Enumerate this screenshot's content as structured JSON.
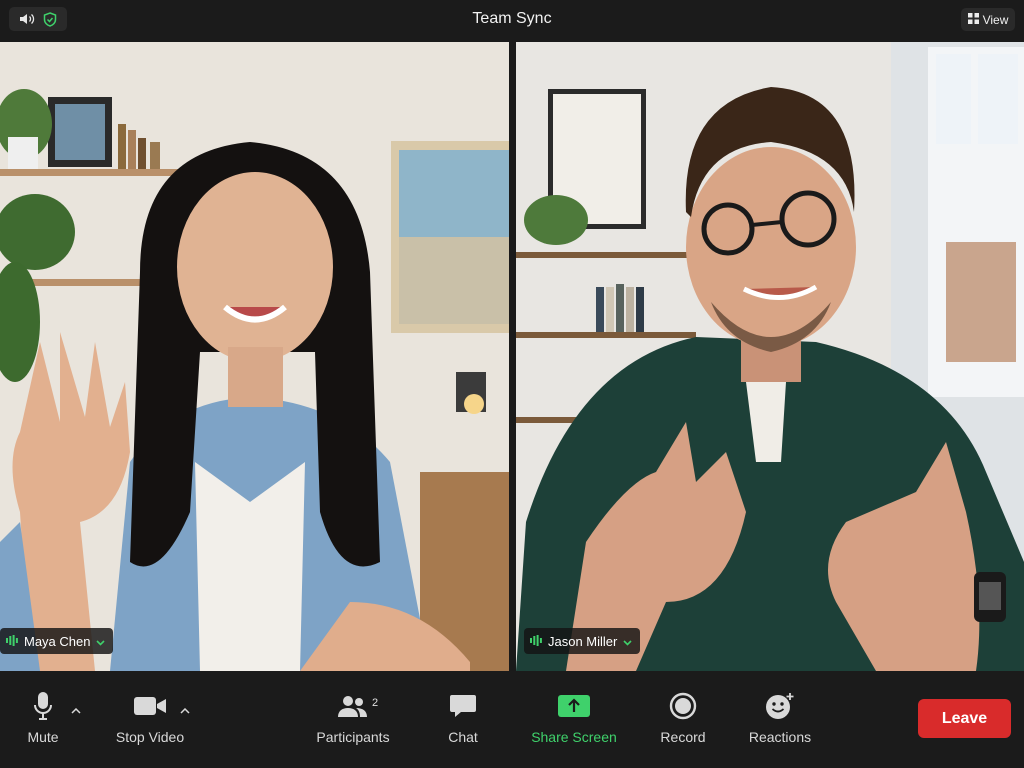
{
  "window": {
    "title": "Team Sync"
  },
  "header": {
    "speaker_icon": "speaker-icon",
    "shield_icon": "shield-check-icon",
    "view_label": "View"
  },
  "participants_tiles": [
    {
      "name": "Maya Chen",
      "audio_icon": "audio-level-icon"
    },
    {
      "name": "Jason Miller",
      "audio_icon": "audio-level-icon"
    }
  ],
  "toolbar": {
    "mute_label": "Mute",
    "stop_video_label": "Stop Video",
    "participants_label": "Participants",
    "participants_count": "2",
    "chat_label": "Chat",
    "share_screen_label": "Share Screen",
    "record_label": "Record",
    "reactions_label": "Reactions",
    "leave_label": "Leave"
  },
  "colors": {
    "accent_green": "#3fd16b",
    "leave_red": "#d92b2b",
    "background": "#1b1b1b"
  }
}
